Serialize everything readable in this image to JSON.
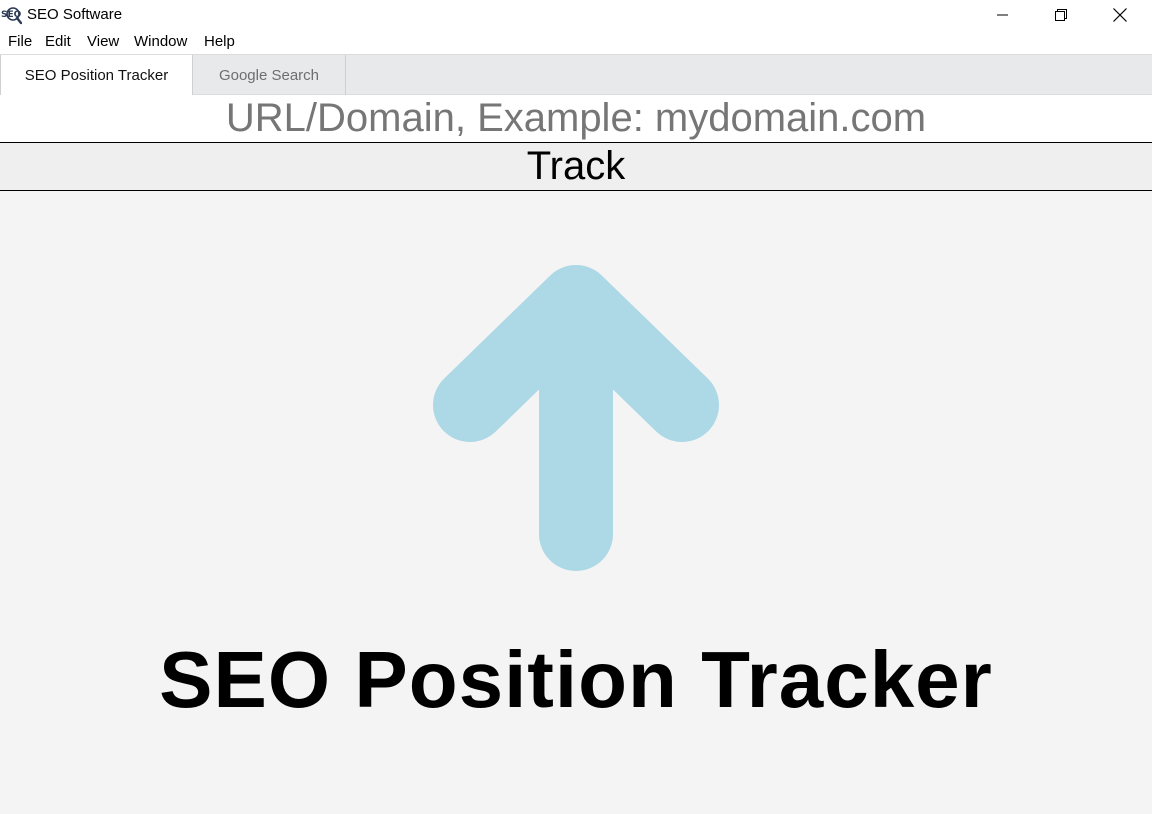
{
  "window": {
    "title": "SEO Software",
    "icon": "seo-magnifier-icon"
  },
  "menu": {
    "items": [
      {
        "label": "File"
      },
      {
        "label": "Edit"
      },
      {
        "label": "View"
      },
      {
        "label": "Window"
      },
      {
        "label": "Help"
      }
    ]
  },
  "tabs": [
    {
      "label": "SEO Position Tracker",
      "active": true
    },
    {
      "label": "Google Search",
      "active": false
    }
  ],
  "tracker": {
    "url_placeholder": "URL/Domain, Example: mydomain.com",
    "url_value": "",
    "track_label": "Track",
    "illustration": "up-arrow-icon",
    "heading": "SEO Position Tracker"
  },
  "colors": {
    "arrow": "#add8e6",
    "background": "#f4f4f4",
    "tab_strip": "#e8e9ea"
  }
}
